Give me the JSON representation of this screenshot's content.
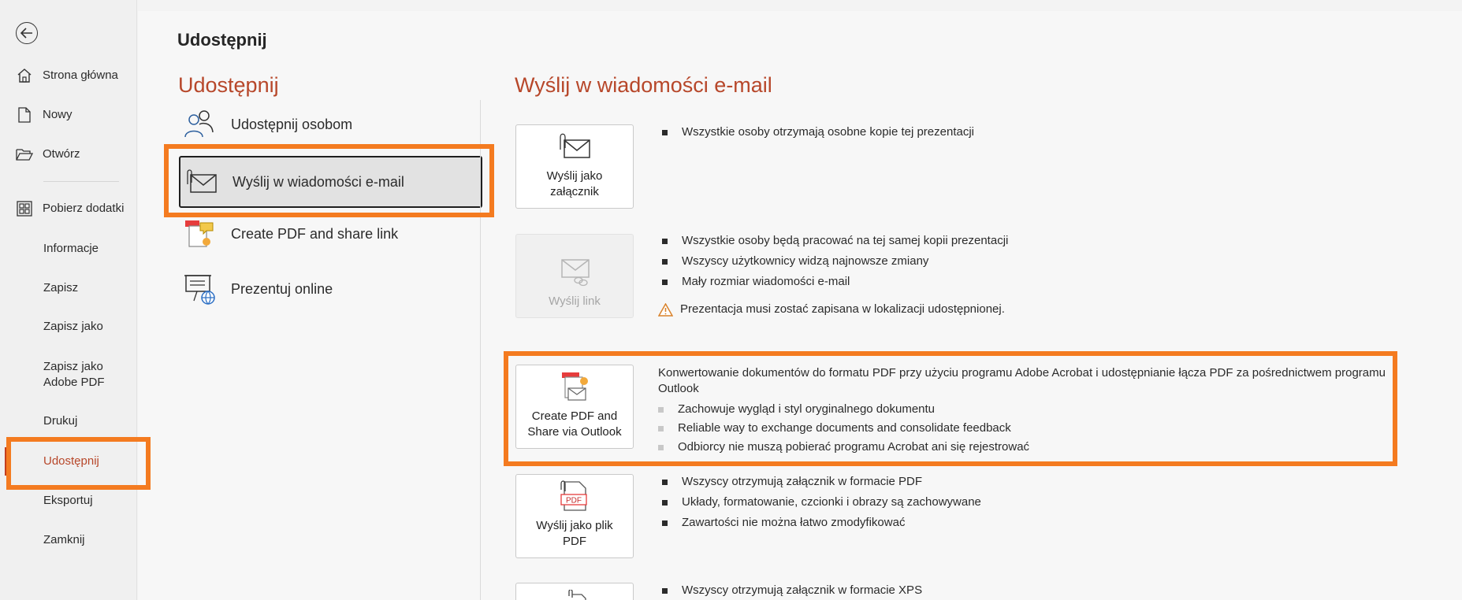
{
  "nav": {
    "items": [
      {
        "label": "Strona główna",
        "icon": "home-icon"
      },
      {
        "label": "Nowy",
        "icon": "new-file-icon"
      },
      {
        "label": "Otwórz",
        "icon": "open-folder-icon"
      },
      {
        "label": "Pobierz dodatki",
        "icon": "add-ins-icon"
      },
      {
        "label": "Informacje"
      },
      {
        "label": "Zapisz"
      },
      {
        "label": "Zapisz jako"
      },
      {
        "label": "Zapisz jako\nAdobe PDF"
      },
      {
        "label": "Drukuj"
      },
      {
        "label": "Udostępnij",
        "active": true
      },
      {
        "label": "Eksportuj"
      },
      {
        "label": "Zamknij"
      }
    ]
  },
  "page_title": "Udostępnij",
  "share_section": {
    "title": "Udostępnij",
    "options": [
      {
        "label": "Udostępnij osobom",
        "icon": "people-icon"
      },
      {
        "label": "Wyślij w wiadomości e-mail",
        "icon": "email-attachment-icon",
        "selected": true
      },
      {
        "label": "Create PDF and share link",
        "icon": "pdf-share-icon"
      },
      {
        "label": "Prezentuj online",
        "icon": "present-online-icon"
      }
    ]
  },
  "email_section": {
    "title": "Wyślij w wiadomości e-mail",
    "attach": {
      "label": "Wyślij jako\nzałącznik",
      "bullets": [
        "Wszystkie osoby otrzymają osobne kopie tej prezentacji"
      ]
    },
    "link": {
      "label": "Wyślij link",
      "bullets": [
        "Wszystkie osoby będą pracować na tej samej kopii prezentacji",
        "Wszyscy użytkownicy widzą najnowsze zmiany",
        "Mały rozmiar wiadomości e-mail"
      ],
      "warning": "Prezentacja musi zostać zapisana w lokalizacji udostępnionej."
    },
    "pdf_outlook": {
      "label": "Create PDF and\nShare via Outlook",
      "description": "Konwertowanie dokumentów do formatu PDF przy użyciu programu Adobe Acrobat i udostępnianie łącza PDF za pośrednictwem programu Outlook",
      "bullets": [
        "Zachowuje wygląd i styl oryginalnego dokumentu",
        "Reliable way to exchange documents and consolidate feedback",
        "Odbiorcy nie muszą pobierać programu Acrobat ani się rejestrować"
      ]
    },
    "pdf": {
      "label": "Wyślij jako plik\nPDF",
      "icon_text": "PDF",
      "bullets": [
        "Wszyscy otrzymują załącznik w formacie PDF",
        "Układy, formatowanie, czcionki i obrazy są zachowywane",
        "Zawartości nie można łatwo zmodyfikować"
      ]
    },
    "xps": {
      "bullets": [
        "Wszyscy otrzymują załącznik w formacie XPS"
      ]
    }
  },
  "colors": {
    "accent": "#b7472a",
    "highlight": "#f47b20"
  }
}
